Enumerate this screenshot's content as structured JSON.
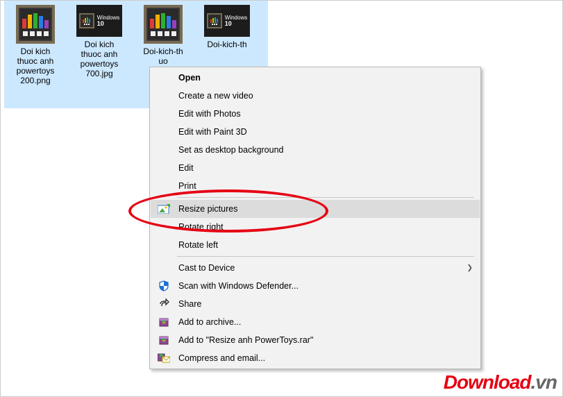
{
  "selection": {
    "files": [
      {
        "icon": "app-big",
        "label": "Doi kich\nthuoc anh\npowertoys\n200.png"
      },
      {
        "icon": "win10",
        "label": "Doi kich\nthuoc anh\npowertoys\n700.jpg"
      },
      {
        "icon": "app-big",
        "label": "Doi-kich-th\nuo\nwe"
      },
      {
        "icon": "win10",
        "label": "Doi-kich-th\n"
      }
    ],
    "win10_badge": {
      "top": "Windows",
      "num": "10"
    }
  },
  "context_menu": {
    "open": "Open",
    "create_video": "Create a new video",
    "edit_photos": "Edit with Photos",
    "edit_paint3d": "Edit with Paint 3D",
    "set_bg": "Set as desktop background",
    "edit": "Edit",
    "print": "Print",
    "resize": "Resize pictures",
    "rotate_right": "Rotate right",
    "rotate_left": "Rotate left",
    "cast": "Cast to Device",
    "defender": "Scan with Windows Defender...",
    "share": "Share",
    "add_archive": "Add to archive...",
    "add_named": "Add to \"Resize anh PowerToys.rar\"",
    "compress_email": "Compress and email..."
  },
  "watermark": {
    "brand": "Download",
    "tld": ".vn"
  },
  "highlight_target": "resize"
}
